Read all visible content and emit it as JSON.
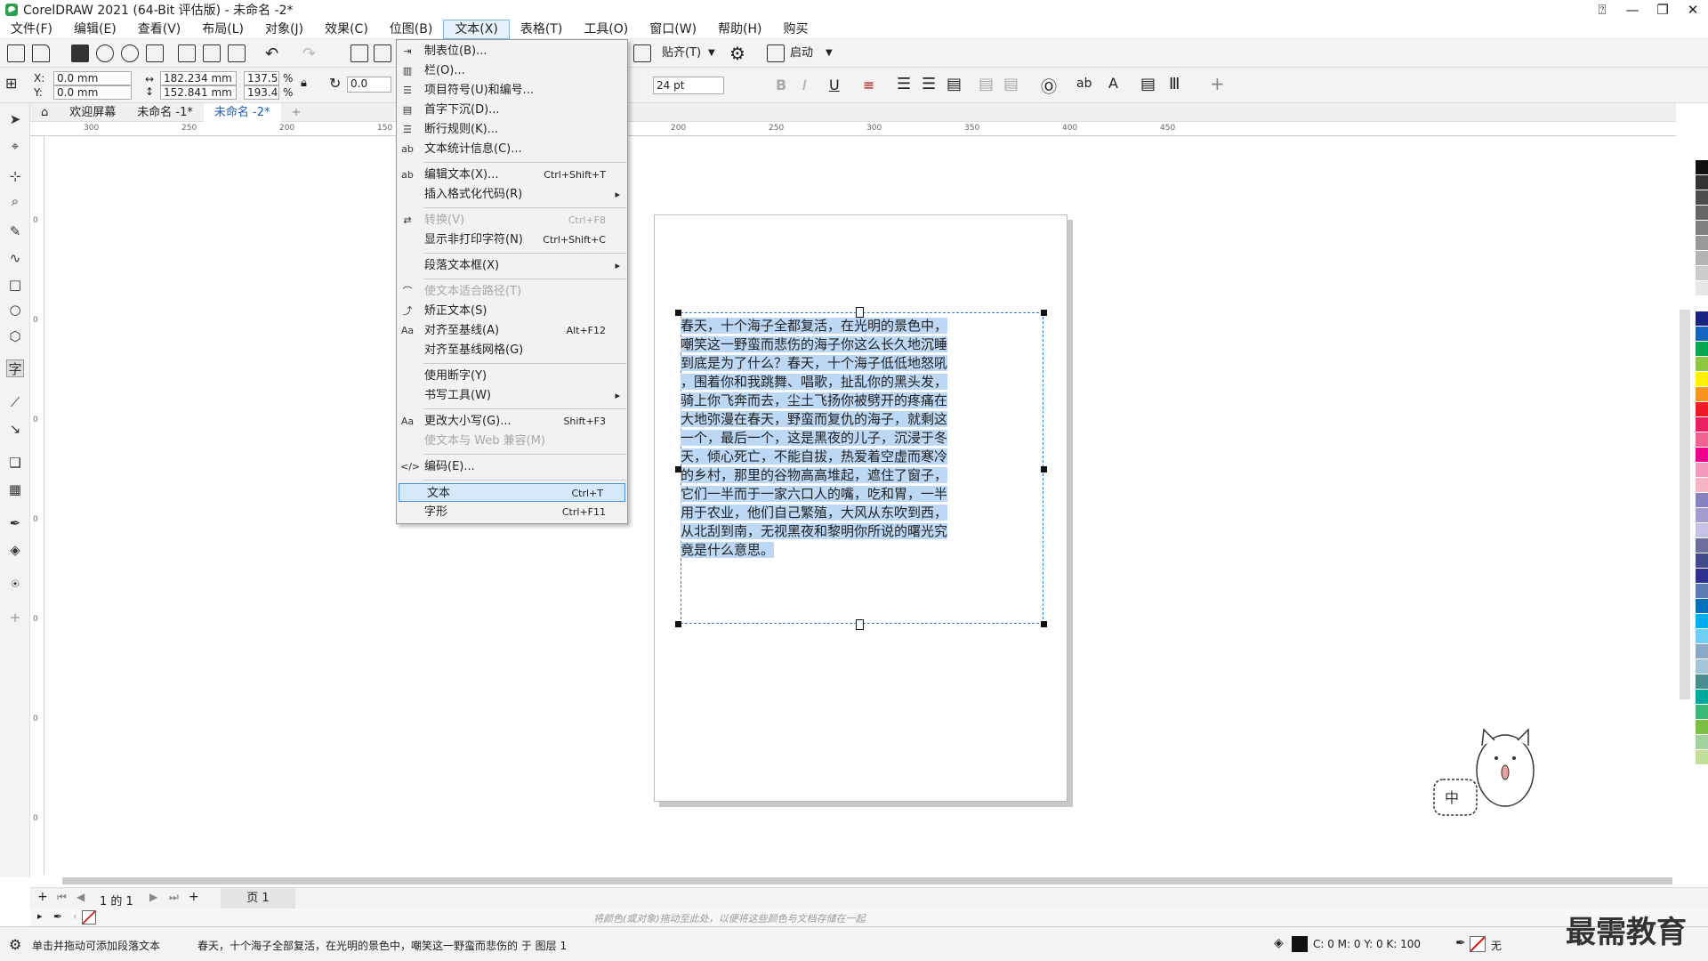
{
  "app": {
    "title": "CorelDRAW 2021 (64-Bit 评估版) - 未命名 -2*"
  },
  "menubar": {
    "items": [
      "文件(F)",
      "编辑(E)",
      "查看(V)",
      "布局(L)",
      "对象(J)",
      "效果(C)",
      "位图(B)",
      "文本(X)",
      "表格(T)",
      "工具(O)",
      "窗口(W)",
      "帮助(H)",
      "购买"
    ],
    "active_index": 7
  },
  "toolbar1": {
    "snap_label": "贴齐(T)",
    "launch_label": "启动"
  },
  "property_bar": {
    "x_label": "X:",
    "y_label": "Y:",
    "x_value": "0.0 mm",
    "y_value": "0.0 mm",
    "width_value": "182.234 mm",
    "height_value": "152.841 mm",
    "scale_x": "137.5",
    "scale_y": "193.4",
    "percent_sign": "%",
    "rotation": "0.0",
    "font_size": "24 pt"
  },
  "tabs": {
    "welcome": "欢迎屏幕",
    "doc1": "未命名 -1*",
    "doc2": "未命名 -2*"
  },
  "ruler": {
    "h_ticks": [
      "300",
      "250",
      "200",
      "150",
      "100",
      "150",
      "200",
      "250",
      "300",
      "350",
      "400",
      "450"
    ],
    "v_ticks": [
      "0",
      "0",
      "0",
      "0",
      "0",
      "0",
      "0",
      "0"
    ]
  },
  "text_menu": {
    "items": [
      {
        "label": "制表位(B)...",
        "shortcut": "",
        "arrow": false,
        "disabled": false,
        "icon": "tab-stops-icon"
      },
      {
        "label": "栏(O)...",
        "shortcut": "",
        "arrow": false,
        "disabled": false,
        "icon": "columns-icon"
      },
      {
        "label": "项目符号(U)和编号...",
        "shortcut": "",
        "arrow": false,
        "disabled": false,
        "icon": "bullets-icon"
      },
      {
        "label": "首字下沉(D)...",
        "shortcut": "",
        "arrow": false,
        "disabled": false,
        "icon": "drop-cap-icon"
      },
      {
        "label": "断行规则(K)...",
        "shortcut": "",
        "arrow": false,
        "disabled": false,
        "icon": "line-break-icon"
      },
      {
        "label": "文本统计信息(C)...",
        "shortcut": "",
        "arrow": false,
        "disabled": false,
        "icon": "text-stats-icon"
      },
      {
        "sep": true
      },
      {
        "label": "编辑文本(X)...",
        "shortcut": "Ctrl+Shift+T",
        "arrow": false,
        "disabled": false,
        "icon": "edit-text-icon"
      },
      {
        "label": "插入格式化代码(R)",
        "shortcut": "",
        "arrow": true,
        "disabled": false,
        "icon": ""
      },
      {
        "sep": true
      },
      {
        "label": "转换(V)",
        "shortcut": "Ctrl+F8",
        "arrow": false,
        "disabled": true,
        "icon": "convert-icon"
      },
      {
        "label": "显示非打印字符(N)",
        "shortcut": "Ctrl+Shift+C",
        "arrow": false,
        "disabled": false,
        "icon": ""
      },
      {
        "sep": true
      },
      {
        "label": "段落文本框(X)",
        "shortcut": "",
        "arrow": true,
        "disabled": false,
        "icon": ""
      },
      {
        "sep": true
      },
      {
        "label": "使文本适合路径(T)",
        "shortcut": "",
        "arrow": false,
        "disabled": true,
        "icon": "fit-path-icon"
      },
      {
        "label": "矫正文本(S)",
        "shortcut": "",
        "arrow": false,
        "disabled": false,
        "icon": "straighten-text-icon"
      },
      {
        "label": "对齐至基线(A)",
        "shortcut": "Alt+F12",
        "arrow": false,
        "disabled": false,
        "icon": "baseline-icon"
      },
      {
        "label": "对齐至基线网格(G)",
        "shortcut": "",
        "arrow": false,
        "disabled": false,
        "icon": ""
      },
      {
        "sep": true
      },
      {
        "label": "使用断字(Y)",
        "shortcut": "",
        "arrow": false,
        "disabled": false,
        "icon": ""
      },
      {
        "label": "书写工具(W)",
        "shortcut": "",
        "arrow": true,
        "disabled": false,
        "icon": ""
      },
      {
        "sep": true
      },
      {
        "label": "更改大小写(G)...",
        "shortcut": "Shift+F3",
        "arrow": false,
        "disabled": false,
        "icon": "change-case-icon"
      },
      {
        "label": "使文本与 Web 兼容(M)",
        "shortcut": "",
        "arrow": false,
        "disabled": true,
        "icon": ""
      },
      {
        "sep": true
      },
      {
        "label": "编码(E)...",
        "shortcut": "",
        "arrow": false,
        "disabled": false,
        "icon": "encoding-icon"
      },
      {
        "sep": true
      },
      {
        "label": "文本",
        "shortcut": "Ctrl+T",
        "arrow": false,
        "disabled": false,
        "icon": "",
        "highlighted": true
      },
      {
        "label": "字形",
        "shortcut": "Ctrl+F11",
        "arrow": false,
        "disabled": false,
        "icon": ""
      }
    ]
  },
  "document": {
    "paragraph_lines": [
      "春天，十个海子全都复活，在光明的景色中，",
      "嘲笑这一野蛮而悲伤的海子你这么长久地沉睡",
      "到底是为了什么？春天，十个海子低低地怒吼",
      "，围着你和我跳舞、唱歌，扯乱你的黑头发，",
      "骑上你飞奔而去，尘土飞扬你被劈开的疼痛在",
      "大地弥漫在春天，野蛮而复仇的海子，就剩这",
      "一个，最后一个，这是黑夜的儿子，沉浸于冬",
      "天，倾心死亡，不能自拔，热爱着空虚而寒冷",
      "的乡村，那里的谷物高高堆起，遮住了窗子，",
      "它们一半而于一家六口人的嘴，吃和胃，一半",
      "用于农业，他们自己繁殖，大风从东吹到西，",
      "从北刮到南，无视黑夜和黎明你所说的曙光究",
      "竟是什么意思。"
    ]
  },
  "pagebar": {
    "page_of": "1 的 1",
    "page_tab": "页 1"
  },
  "colorbar": {
    "hint": "将颜色(或对象)拖动至此处，以便将这些颜色与文档存储在一起"
  },
  "statusbar": {
    "left_text": "单击并拖动可添加段落文本",
    "middle_text": "春天，十个海子全部复活，在光明的景色中，嘲笑这一野蛮而悲伤的 于 图层 1",
    "color_values": "C: 0 M: 0 Y: 0 K: 100",
    "outline_label": "无"
  },
  "watermark": {
    "text": "最需教育"
  },
  "mascot": {
    "bubble_text": "中"
  },
  "palette_colors": [
    "#111111",
    "#333333",
    "#4d4d4d",
    "#666666",
    "#808080",
    "#999999",
    "#b3b3b3",
    "#cccccc",
    "#e6e6e6",
    "#ffffff",
    "#1a237e",
    "#1565c0",
    "#00a651",
    "#8dc63f",
    "#fff200",
    "#f7941d",
    "#ed1c24",
    "#e91e63",
    "#f06292",
    "#ec008c",
    "#f49ac1",
    "#f9b4c3",
    "#8781bd",
    "#a59bd0",
    "#c5c1e5",
    "#6d6e9c",
    "#404a8a",
    "#2e3192",
    "#5b7bb5",
    "#0072bc",
    "#00aeef",
    "#6dcff6",
    "#8ba8c8",
    "#a4c4d8",
    "#4b8c8c",
    "#00a99d",
    "#3cb878",
    "#7ac143",
    "#a3d39c",
    "#c4df9b"
  ]
}
